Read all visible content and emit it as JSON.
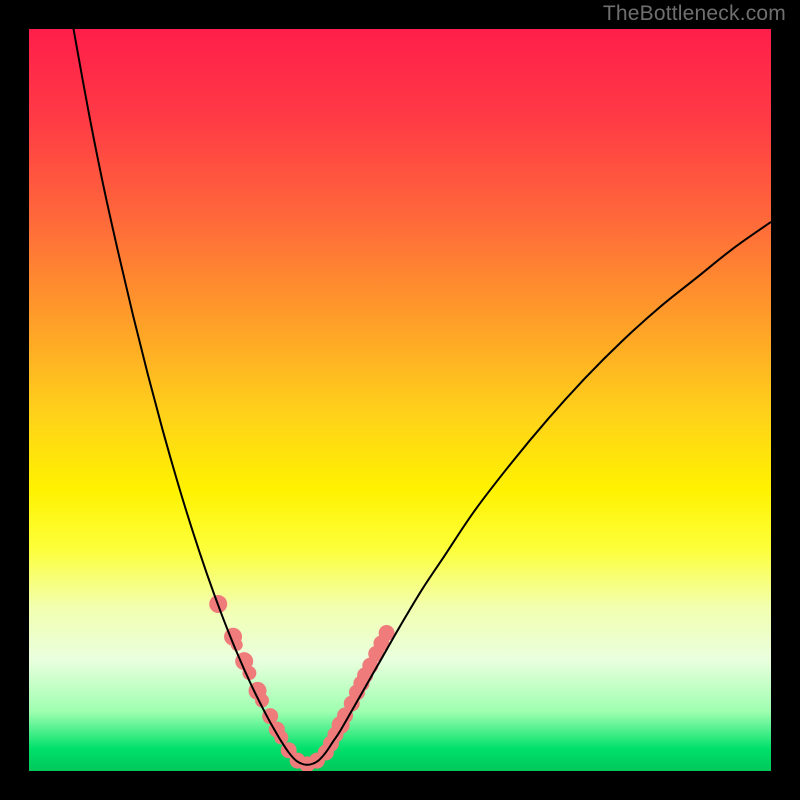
{
  "watermark": "TheBottleneck.com",
  "chart_data": {
    "type": "line",
    "title": "",
    "xlabel": "",
    "ylabel": "",
    "ylim": [
      0,
      100
    ],
    "xlim": [
      0,
      100
    ],
    "series": [
      {
        "name": "left-curve",
        "x": [
          6,
          8,
          10,
          12,
          14,
          16,
          18,
          20,
          22,
          24,
          26,
          28,
          30,
          32,
          33,
          34,
          35
        ],
        "values": [
          100,
          89,
          79,
          70,
          61.5,
          53.5,
          46,
          39,
          32.5,
          26.5,
          21,
          16,
          11.5,
          7.5,
          5.7,
          4,
          2.5
        ]
      },
      {
        "name": "right-curve",
        "x": [
          40,
          41,
          42,
          44,
          46,
          48,
          50,
          53,
          56,
          60,
          65,
          70,
          75,
          80,
          85,
          90,
          95,
          100
        ],
        "values": [
          2.5,
          4,
          5.5,
          9,
          12.5,
          16,
          19.5,
          24.5,
          29,
          35,
          41.5,
          47.5,
          53,
          58,
          62.5,
          66.5,
          70.5,
          74
        ]
      },
      {
        "name": "floor",
        "x": [
          35,
          36,
          37,
          38,
          39,
          40
        ],
        "values": [
          2.5,
          1.4,
          0.9,
          0.9,
          1.4,
          2.5
        ]
      }
    ],
    "markers": {
      "name": "location-dots",
      "x_pct": [
        25.5,
        27.5,
        28.0,
        29.0,
        29.7,
        30.8,
        31.4,
        32.5,
        33.4,
        34.0,
        35.0,
        36.2,
        37.5,
        38.8,
        40.0,
        40.7,
        41.3,
        42.0,
        42.6,
        43.5,
        44.2,
        44.8,
        45.3,
        46.0,
        46.8,
        47.5,
        48.2
      ],
      "y_pct": [
        22.5,
        18.1,
        17.0,
        14.8,
        13.2,
        10.8,
        9.5,
        7.4,
        5.6,
        4.5,
        2.8,
        1.4,
        0.9,
        1.4,
        2.5,
        3.7,
        4.9,
        6.2,
        7.5,
        9.1,
        10.6,
        11.8,
        12.9,
        14.2,
        15.8,
        17.2,
        18.6
      ],
      "radius_px": [
        9,
        9,
        6,
        9,
        7,
        9,
        7,
        8,
        8,
        7,
        8,
        8,
        8,
        8,
        8,
        8,
        8,
        9,
        8,
        8,
        8,
        8,
        8,
        8,
        8,
        8,
        8
      ],
      "color": "#ef7b7b"
    }
  }
}
